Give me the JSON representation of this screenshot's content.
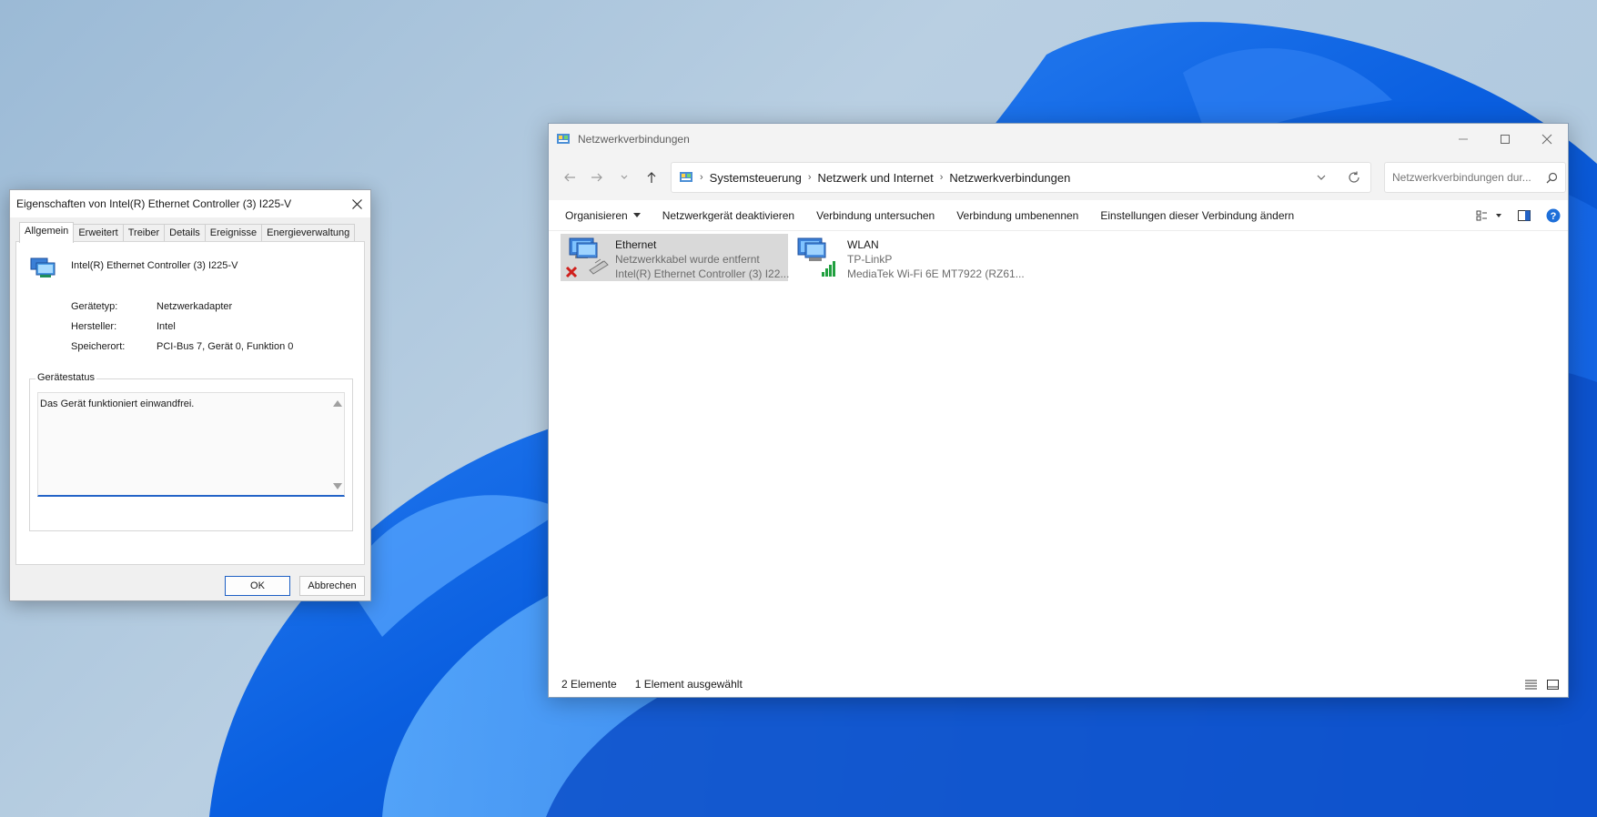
{
  "colors": {
    "accent": "#2363c7",
    "wallpaper_blue": "#1e6fe0",
    "error_red": "#d0201c",
    "signal_green": "#21a040"
  },
  "explorer": {
    "title": "Netzwerkverbindungen",
    "breadcrumb": [
      "Systemsteuerung",
      "Netzwerk und Internet",
      "Netzwerkverbindungen"
    ],
    "search_placeholder": "Netzwerkverbindungen dur...",
    "toolbar": {
      "organize": "Organisieren",
      "disable": "Netzwerkgerät deaktivieren",
      "diagnose": "Verbindung untersuchen",
      "rename": "Verbindung umbenennen",
      "settings": "Einstellungen dieser Verbindung ändern"
    },
    "connections": [
      {
        "name": "Ethernet",
        "status": "Netzwerkkabel wurde entfernt",
        "device": "Intel(R) Ethernet Controller (3) I22...",
        "selected": true,
        "icon": "ethernet-disconnected-icon"
      },
      {
        "name": "WLAN",
        "status": "TP-LinkP",
        "device": "MediaTek Wi-Fi 6E MT7922 (RZ61...",
        "selected": false,
        "icon": "wifi-connected-icon"
      }
    ],
    "statusbar": {
      "count": "2 Elemente",
      "selected": "1 Element ausgewählt"
    }
  },
  "dialog": {
    "title": "Eigenschaften von Intel(R) Ethernet Controller (3) I225-V",
    "tabs": [
      "Allgemein",
      "Erweitert",
      "Treiber",
      "Details",
      "Ereignisse",
      "Energieverwaltung"
    ],
    "active_tab": "Allgemein",
    "device_name": "Intel(R) Ethernet Controller (3) I225-V",
    "properties": [
      {
        "label": "Gerätetyp:",
        "value": "Netzwerkadapter"
      },
      {
        "label": "Hersteller:",
        "value": "Intel"
      },
      {
        "label": "Speicherort:",
        "value": "PCI-Bus 7, Gerät 0, Funktion 0"
      }
    ],
    "status_group": "Gerätestatus",
    "status_text": "Das Gerät funktioniert einwandfrei.",
    "ok": "OK",
    "cancel": "Abbrechen"
  }
}
